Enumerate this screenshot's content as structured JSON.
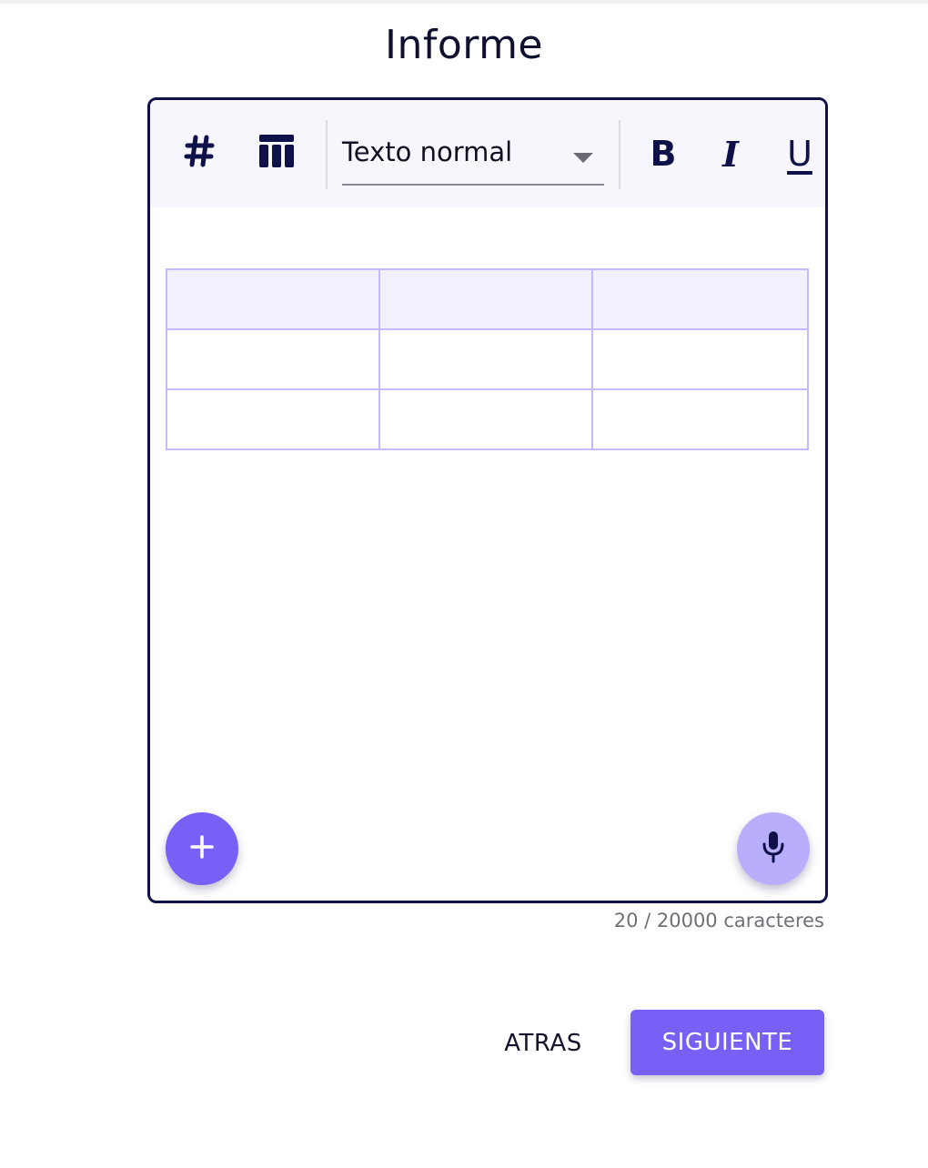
{
  "page": {
    "title": "Informe"
  },
  "toolbar": {
    "icons": {
      "hash": "hash-icon",
      "table": "table-icon",
      "bold": "bold-icon",
      "italic": "italic-icon",
      "underline": "underline-icon"
    },
    "paragraph_style": {
      "selected": "Texto normal"
    },
    "bold_label": "B",
    "italic_label": "I",
    "underline_label": "U"
  },
  "editor": {
    "table": {
      "rows": [
        [
          "",
          "",
          ""
        ],
        [
          "",
          "",
          ""
        ],
        [
          "",
          "",
          ""
        ]
      ]
    },
    "add_button": {
      "label": "+"
    },
    "mic_button": {
      "icon": "microphone-icon"
    }
  },
  "counter": {
    "text": "20 / 20000 caracteres"
  },
  "actions": {
    "back_label": "ATRAS",
    "next_label": "SIGUIENTE"
  },
  "colors": {
    "accent": "#7660f6",
    "accent_light": "#b8aefc",
    "navy": "#0f1248",
    "table_border": "#c7b9ff",
    "table_header_bg": "#f1f0fc",
    "toolbar_bg": "#f6f6fc"
  }
}
